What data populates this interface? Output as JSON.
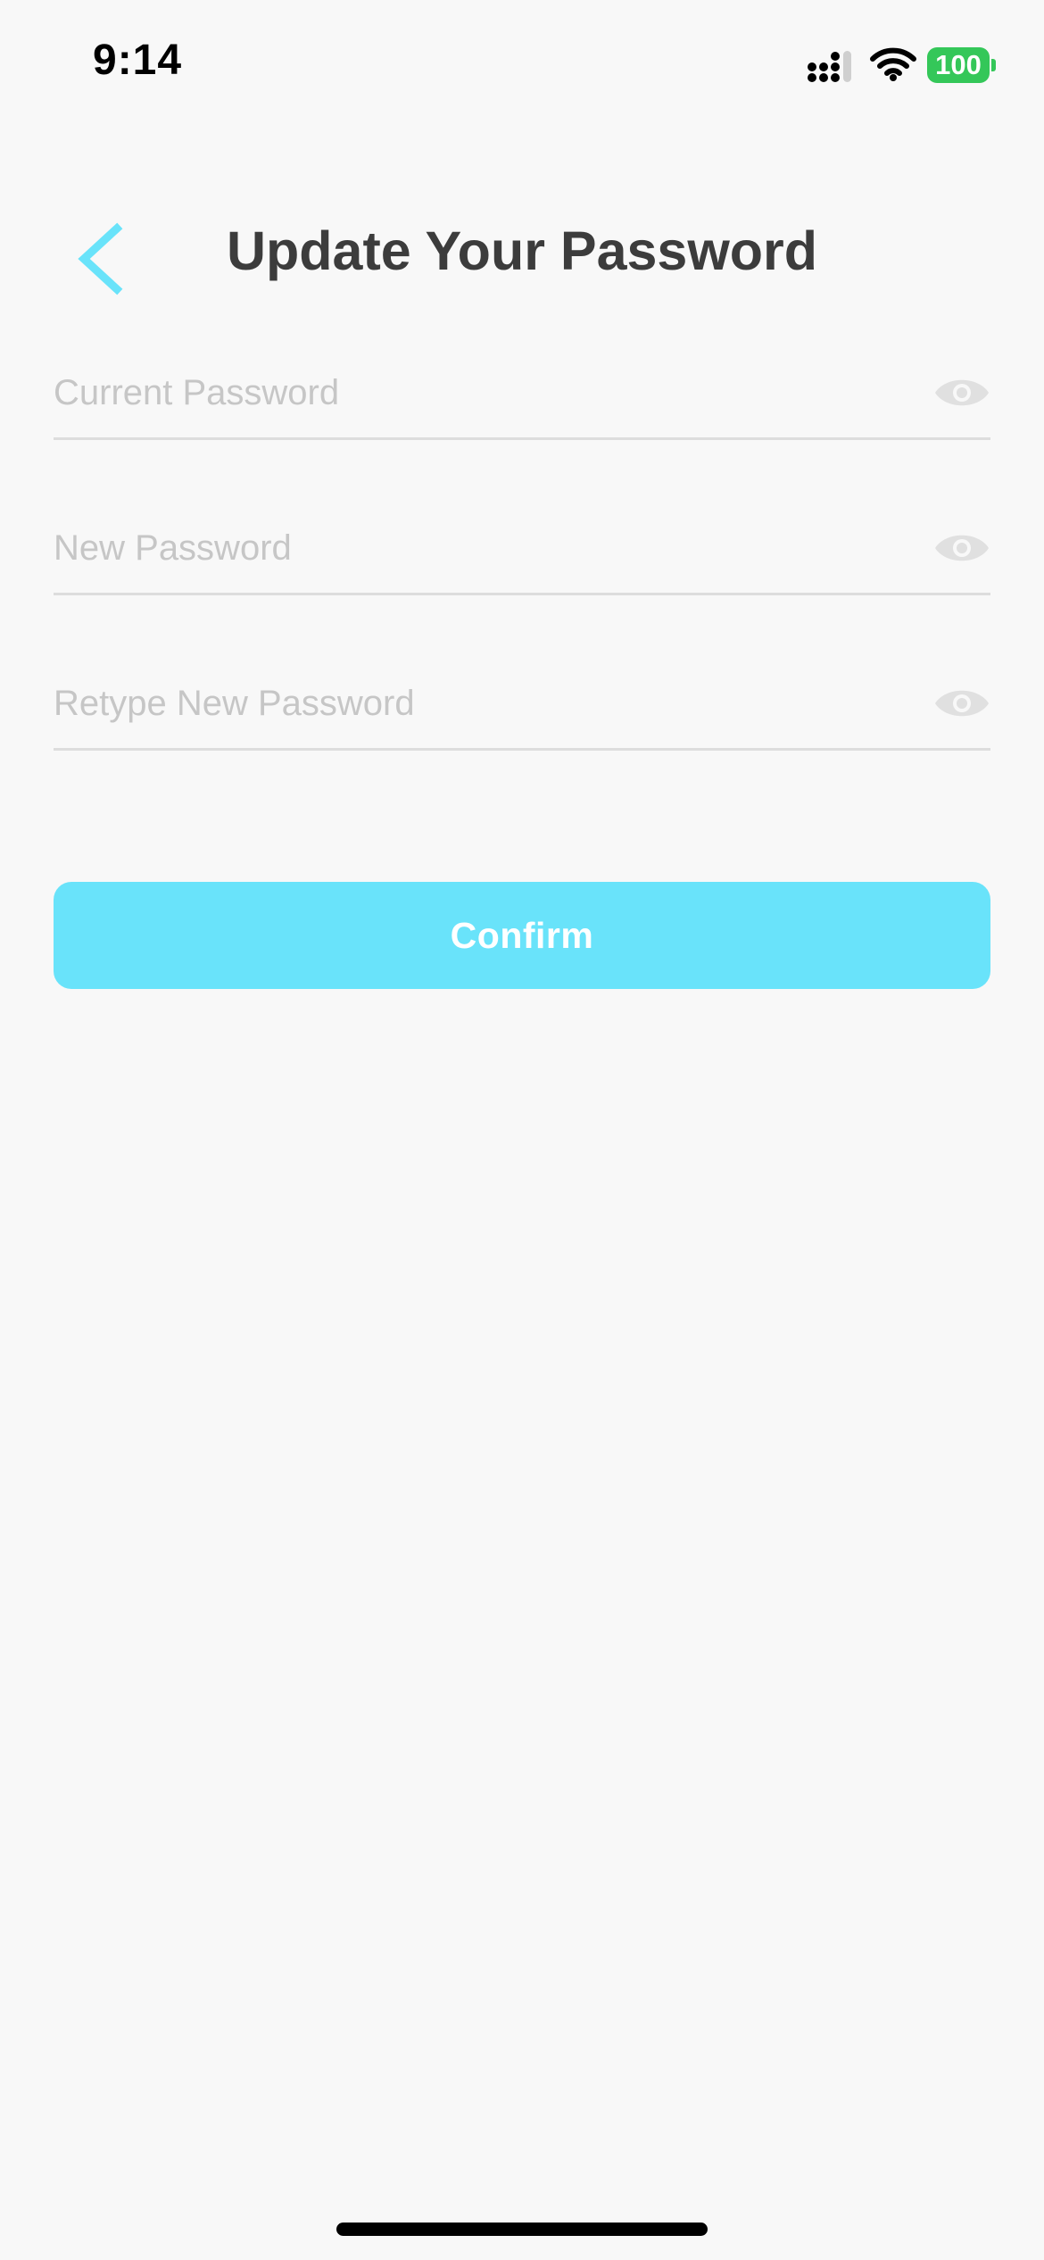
{
  "status_bar": {
    "time": "9:14",
    "battery": "100",
    "icons": [
      "signal-icon",
      "wifi-icon",
      "battery-icon"
    ]
  },
  "header": {
    "title": "Update Your Password",
    "back_icon": "chevron-left-icon"
  },
  "form": {
    "fields": [
      {
        "placeholder": "Current Password",
        "value": "",
        "icon": "eye-icon"
      },
      {
        "placeholder": "New Password",
        "value": "",
        "icon": "eye-icon"
      },
      {
        "placeholder": "Retype New Password",
        "value": "",
        "icon": "eye-icon"
      }
    ],
    "confirm_label": "Confirm"
  },
  "colors": {
    "accent": "#69e3fa",
    "title": "#3c3c3c",
    "placeholder": "#c6c6c6",
    "divider": "#dddddd",
    "background": "#f8f8f8",
    "battery": "#34c759"
  }
}
